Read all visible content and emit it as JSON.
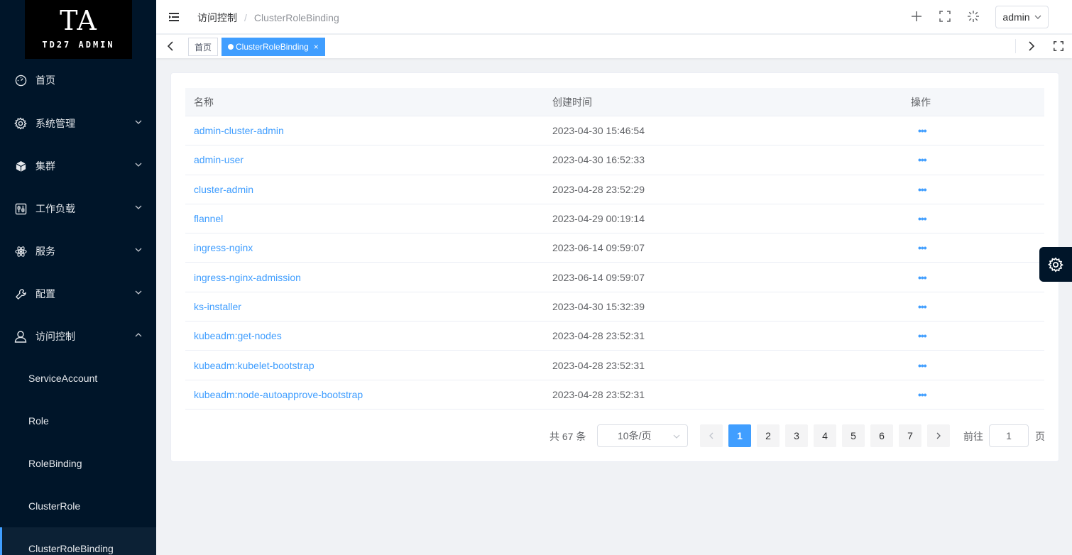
{
  "logo": {
    "main": "TA",
    "sub": "TD27 ADMIN"
  },
  "sidebar": {
    "items": [
      {
        "label": "首页",
        "icon": "dashboard-icon"
      },
      {
        "label": "系统管理",
        "icon": "gear-icon"
      },
      {
        "label": "集群",
        "icon": "cube-icon"
      },
      {
        "label": "工作负载",
        "icon": "sliders-icon"
      },
      {
        "label": "服务",
        "icon": "atom-icon"
      },
      {
        "label": "配置",
        "icon": "wrench-icon"
      },
      {
        "label": "访问控制",
        "icon": "user-icon"
      }
    ],
    "subitems": [
      {
        "label": "ServiceAccount"
      },
      {
        "label": "Role"
      },
      {
        "label": "RoleBinding"
      },
      {
        "label": "ClusterRole"
      },
      {
        "label": "ClusterRoleBinding"
      }
    ]
  },
  "header": {
    "breadcrumb": {
      "parent": "访问控制",
      "separator": "/",
      "current": "ClusterRoleBinding"
    },
    "user": "admin"
  },
  "tabs": [
    {
      "label": "首页",
      "active": false
    },
    {
      "label": "ClusterRoleBinding",
      "active": true,
      "close": "×"
    }
  ],
  "table": {
    "columns": [
      "名称",
      "创建时间",
      "操作"
    ],
    "rows": [
      {
        "name": "admin-cluster-admin",
        "created": "2023-04-30 15:46:54",
        "action": "•••"
      },
      {
        "name": "admin-user",
        "created": "2023-04-30 16:52:33",
        "action": "•••"
      },
      {
        "name": "cluster-admin",
        "created": "2023-04-28 23:52:29",
        "action": "•••"
      },
      {
        "name": "flannel",
        "created": "2023-04-29 00:19:14",
        "action": "•••"
      },
      {
        "name": "ingress-nginx",
        "created": "2023-06-14 09:59:07",
        "action": "•••"
      },
      {
        "name": "ingress-nginx-admission",
        "created": "2023-06-14 09:59:07",
        "action": "•••"
      },
      {
        "name": "ks-installer",
        "created": "2023-04-30 15:32:39",
        "action": "•••"
      },
      {
        "name": "kubeadm:get-nodes",
        "created": "2023-04-28 23:52:31",
        "action": "•••"
      },
      {
        "name": "kubeadm:kubelet-bootstrap",
        "created": "2023-04-28 23:52:31",
        "action": "•••"
      },
      {
        "name": "kubeadm:node-autoapprove-bootstrap",
        "created": "2023-04-28 23:52:31",
        "action": "•••"
      }
    ]
  },
  "pagination": {
    "total": "共 67 条",
    "page_size": "10条/页",
    "pages": [
      "1",
      "2",
      "3",
      "4",
      "5",
      "6",
      "7"
    ],
    "current": "1",
    "goto_label": "前往",
    "goto_value": "1",
    "page_suffix": "页"
  },
  "colors": {
    "sidebar_bg": "#001529",
    "accent": "#409eff"
  }
}
